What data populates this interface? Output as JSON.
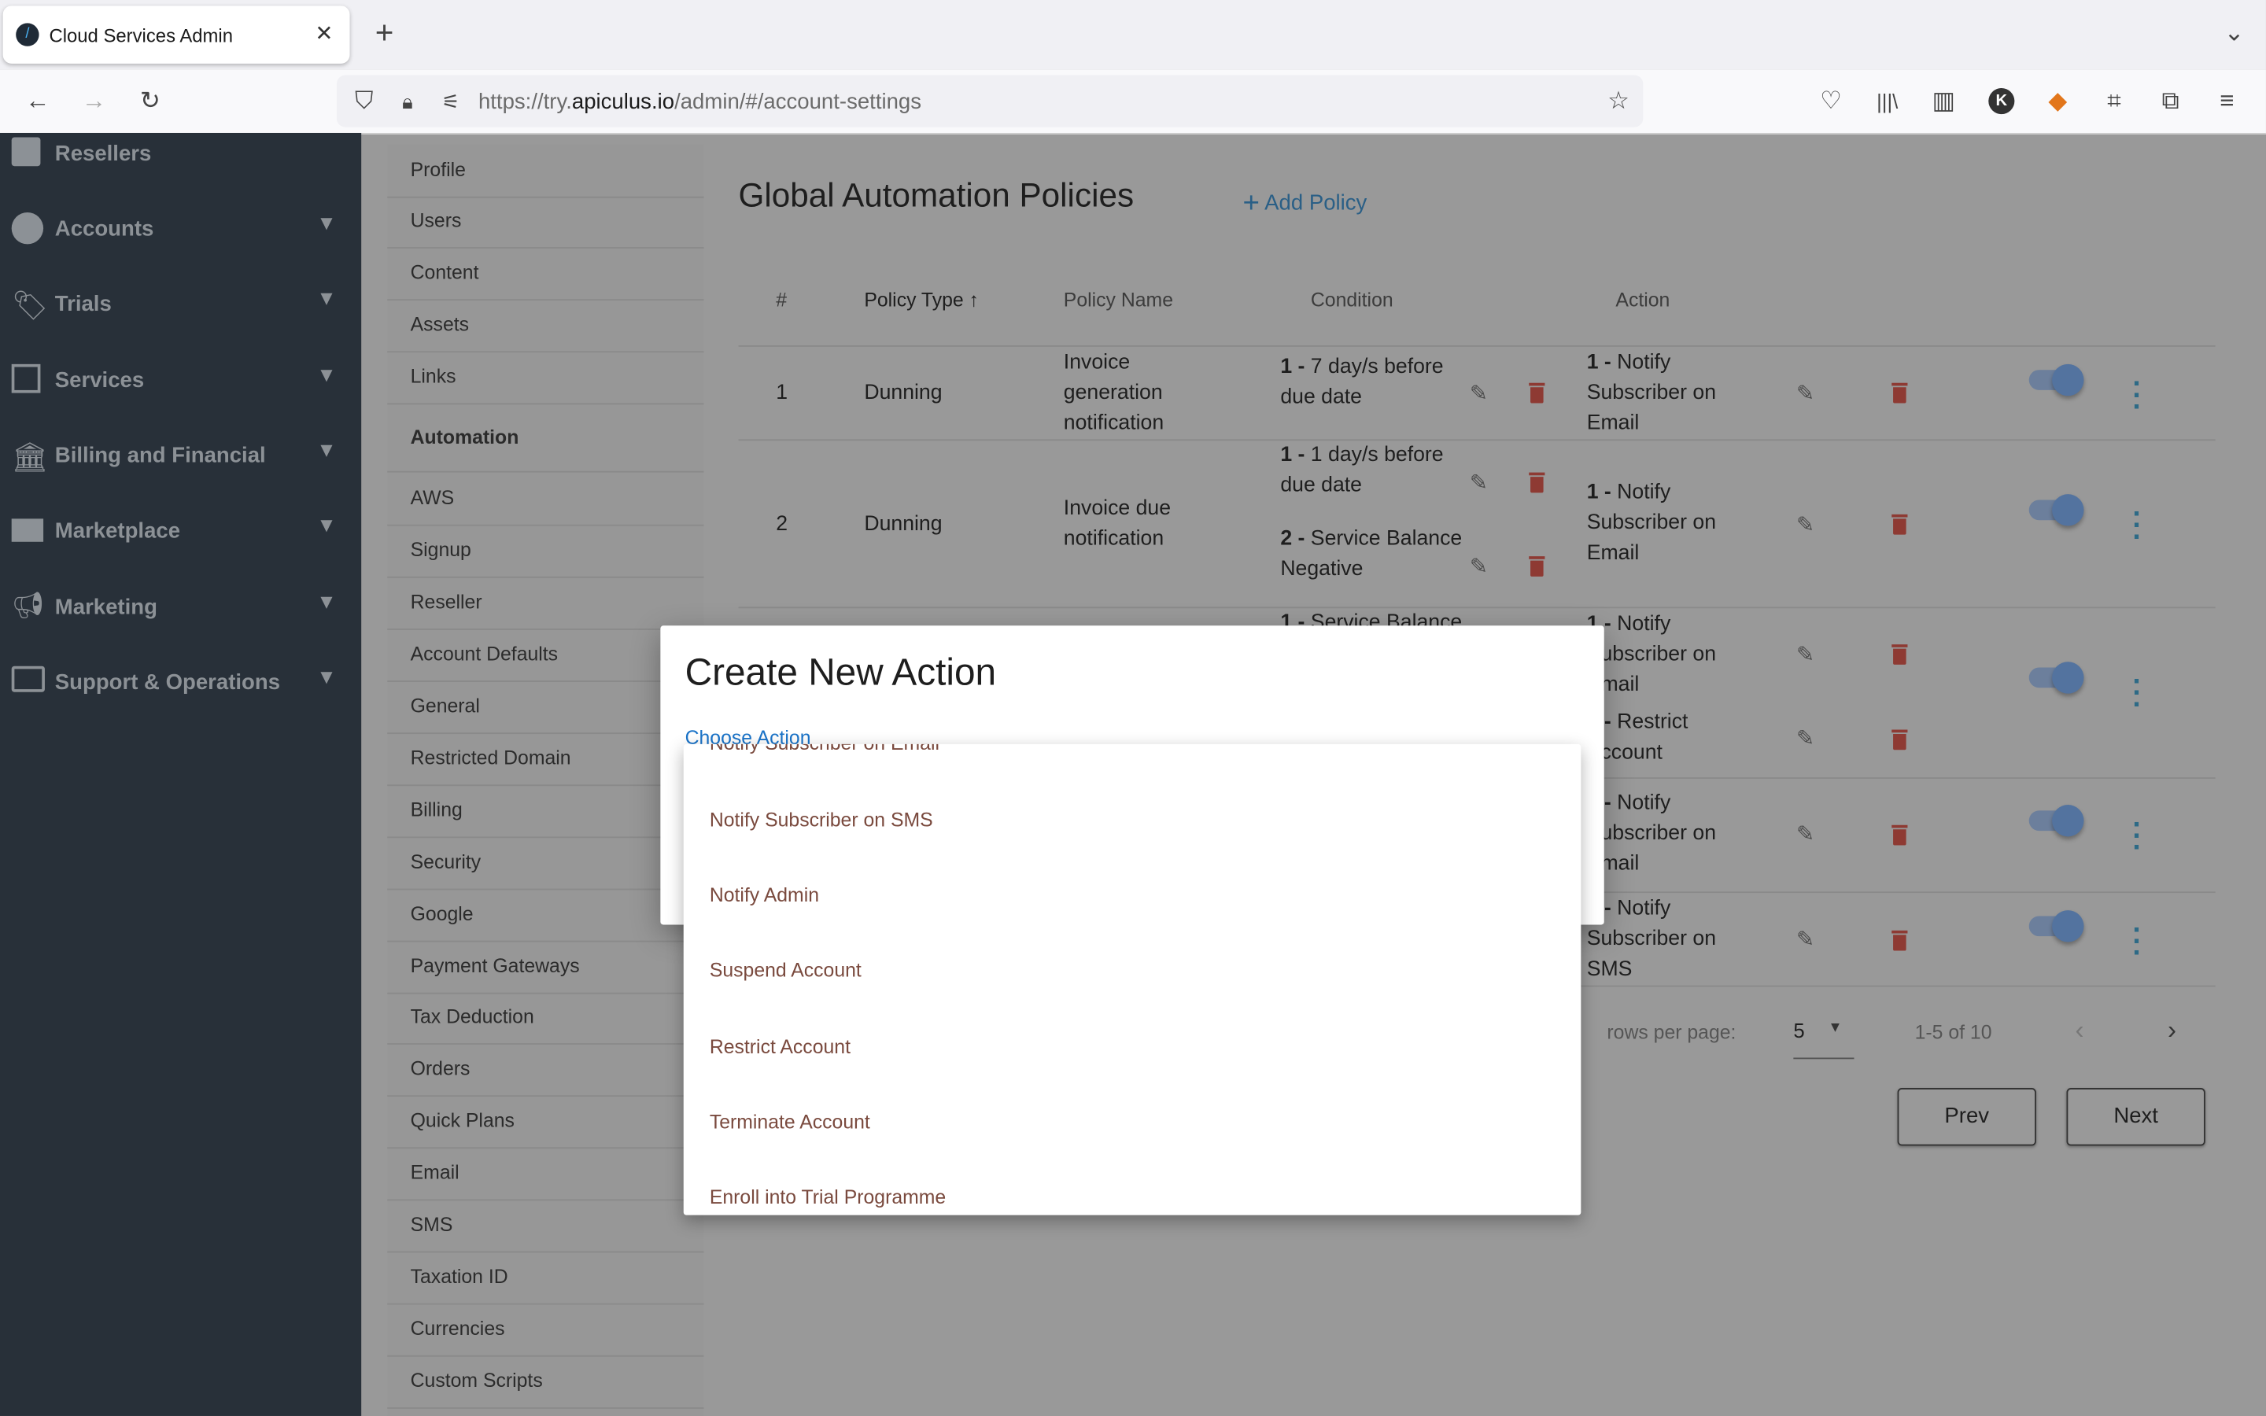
{
  "browser": {
    "tab_title": "Cloud Services Admin",
    "url_prefix": "https://try.",
    "url_domain": "apiculus.io",
    "url_path": "/admin/#/account-settings"
  },
  "sidebar": {
    "items": [
      {
        "label": "Resellers",
        "icon": "reseller-icon"
      },
      {
        "label": "Accounts",
        "icon": "account-circle-icon"
      },
      {
        "label": "Trials",
        "icon": "tag-heart-icon"
      },
      {
        "label": "Services",
        "icon": "library-icon"
      },
      {
        "label": "Billing and Financial",
        "icon": "bank-icon"
      },
      {
        "label": "Marketplace",
        "icon": "store-icon"
      },
      {
        "label": "Marketing",
        "icon": "megaphone-icon"
      },
      {
        "label": "Support & Operations",
        "icon": "monitor-icon"
      }
    ]
  },
  "submenu": {
    "items": [
      "Profile",
      "Users",
      "Content",
      "Assets",
      "Links",
      "Automation",
      "AWS",
      "Signup",
      "Reseller",
      "Account Defaults",
      "General",
      "Restricted Domain",
      "Billing",
      "Security",
      "Google",
      "Payment Gateways",
      "Tax Deduction",
      "Orders",
      "Quick Plans",
      "Email",
      "SMS",
      "Taxation ID",
      "Currencies",
      "Custom Scripts"
    ],
    "active": "Automation"
  },
  "main": {
    "title": "Global Automation Policies",
    "add_policy": "Add Policy",
    "columns": {
      "num": "#",
      "type": "Policy Type",
      "name": "Policy Name",
      "condition": "Condition",
      "action": "Action"
    },
    "rows": [
      {
        "num": "1",
        "type": "Dunning",
        "name": "Invoice generation notification",
        "conditions": [
          {
            "n": "1 -",
            "text": "7 day/s before due date"
          }
        ],
        "actions": [
          {
            "n": "1 -",
            "text": "Notify Subscriber on Email"
          }
        ]
      },
      {
        "num": "2",
        "type": "Dunning",
        "name": "Invoice due notification",
        "conditions": [
          {
            "n": "1 -",
            "text": "1 day/s before due date"
          },
          {
            "n": "2 -",
            "text": "Service Balance Negative"
          }
        ],
        "actions": [
          {
            "n": "1 -",
            "text": "Notify Subscriber on Email"
          }
        ]
      },
      {
        "conditions": [
          {
            "n": "1 -",
            "text": "Service Balance"
          }
        ],
        "actions": [
          {
            "n": "1 -",
            "text": "Notify Subscriber on Email"
          },
          {
            "n": "2 -",
            "text": "Restrict Account"
          }
        ]
      },
      {
        "actions": [
          {
            "n": "1 -",
            "text": "Notify Subscriber on Email"
          }
        ]
      },
      {
        "actions": [
          {
            "n": "1 -",
            "text": "Notify Subscriber on SMS"
          }
        ]
      }
    ],
    "pagination": {
      "rows_label": "rows per page:",
      "rows_value": "5",
      "range": "1-5 of 10"
    },
    "prev": "Prev",
    "next": "Next"
  },
  "modal": {
    "title": "Create New Action",
    "field_label": "Choose Action",
    "options": [
      "Notify Subscriber on Email",
      "Notify Subscriber on SMS",
      "Notify Admin",
      "Suspend Account",
      "Restrict Account",
      "Terminate Account",
      "Enroll into Trial Programme"
    ]
  },
  "colors": {
    "sidebar": "#283039",
    "accent": "#1a73c8",
    "delete": "#8e3a33",
    "toggle": "#53739f"
  }
}
